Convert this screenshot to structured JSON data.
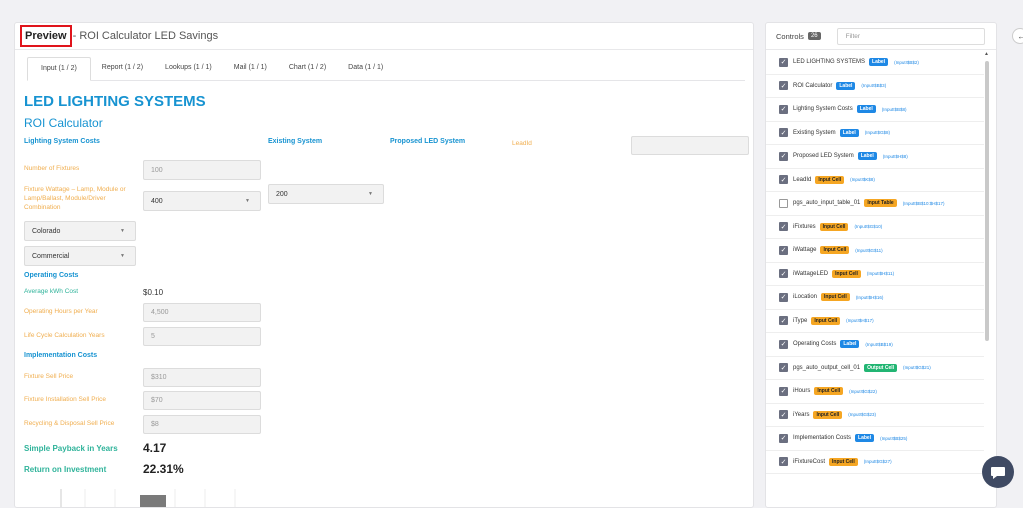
{
  "header": {
    "preview_label": "Preview",
    "title_rest": "- ROI Calculator LED Savings"
  },
  "tabs": [
    "Input (1 / 2)",
    "Report (1 / 2)",
    "Lookups (1 / 1)",
    "Mail (1 / 1)",
    "Chart (1 / 2)",
    "Data (1 / 1)"
  ],
  "sheet": {
    "title": "LED LIGHTING SYSTEMS",
    "subtitle": "ROI Calculator",
    "lighting_costs": "Lighting System Costs",
    "existing_system": "Existing System",
    "proposed_system": "Proposed LED System",
    "leadid_label": "LeadId",
    "leadid_value": "",
    "num_fixtures_label": "Number of Fixtures",
    "num_fixtures_value": "100",
    "wattage_label_1": "Fixture Wattage – Lamp, Module or",
    "wattage_label_2": "Lamp/Ballast, Module/Driver",
    "wattage_label_3": "Combination",
    "wattage_existing": "400",
    "wattage_led": "200",
    "location_value": "Colorado",
    "type_value": "Commercial",
    "operating_costs": "Operating Costs",
    "avg_kwh_label": "Average kWh Cost",
    "avg_kwh_value": "$0.10",
    "hours_label": "Operating Hours per Year",
    "hours_value": "4,500",
    "years_label": "Life Cycle Calculation Years",
    "years_value": "5",
    "implementation_costs": "Implementation Costs",
    "fixture_price_label": "Fixture Sell Price",
    "fixture_price_value": "$310",
    "install_price_label": "Fixture Installation Sell Price",
    "install_price_value": "$70",
    "recycle_label": "Recycling & Disposal Sell Price",
    "recycle_value": "$8",
    "payback_label": "Simple Payback in Years",
    "payback_value": "4.17",
    "roi_label": "Return on Investment",
    "roi_value": "22.31%"
  },
  "controls": {
    "title": "Controls",
    "count": "26",
    "filter_placeholder": "Filter",
    "items": [
      {
        "name": "LED LIGHTING SYSTEMS",
        "tag": "Label",
        "kind": "label",
        "ref": "(Input!$B$2)",
        "checked": true
      },
      {
        "name": "ROI Calculator",
        "tag": "Label",
        "kind": "label",
        "ref": "(Input!$B$3)",
        "checked": true
      },
      {
        "name": "Lighting System Costs",
        "tag": "Label",
        "kind": "label",
        "ref": "(Input!$B$8)",
        "checked": true
      },
      {
        "name": "Existing System",
        "tag": "Label",
        "kind": "label",
        "ref": "(Input!$G$8)",
        "checked": true
      },
      {
        "name": "Proposed LED System",
        "tag": "Label",
        "kind": "label",
        "ref": "(Input!$H$8)",
        "checked": true
      },
      {
        "name": "LeadId",
        "tag": "Input Cell",
        "kind": "input",
        "ref": "(Input!$K$8)",
        "checked": true
      },
      {
        "name": "pgs_auto_input_table_01",
        "tag": "Input Table",
        "kind": "input",
        "ref": "(Input!$B$10:$H$17)",
        "checked": false
      },
      {
        "name": "iFixtures",
        "tag": "Input Cell",
        "kind": "input",
        "ref": "(Input!$G$10)",
        "checked": true
      },
      {
        "name": "iWattage",
        "tag": "Input Cell",
        "kind": "input",
        "ref": "(Input!$G$11)",
        "checked": true
      },
      {
        "name": "iWattageLED",
        "tag": "Input Cell",
        "kind": "input",
        "ref": "(Input!$H$11)",
        "checked": true
      },
      {
        "name": "iLocation",
        "tag": "Input Cell",
        "kind": "input",
        "ref": "(Input!$H$16)",
        "checked": true
      },
      {
        "name": "iType",
        "tag": "Input Cell",
        "kind": "input",
        "ref": "(Input!$H$17)",
        "checked": true
      },
      {
        "name": "Operating Costs",
        "tag": "Label",
        "kind": "label",
        "ref": "(Input!$B$19)",
        "checked": true
      },
      {
        "name": "pgs_auto_output_cell_01",
        "tag": "Output Cell",
        "kind": "output",
        "ref": "(Input!$G$21)",
        "checked": true
      },
      {
        "name": "iHours",
        "tag": "Input Cell",
        "kind": "input",
        "ref": "(Input!$G$22)",
        "checked": true
      },
      {
        "name": "iYears",
        "tag": "Input Cell",
        "kind": "input",
        "ref": "(Input!$G$23)",
        "checked": true
      },
      {
        "name": "Implementation Costs",
        "tag": "Label",
        "kind": "label",
        "ref": "(Input!$B$25)",
        "checked": true
      },
      {
        "name": "iFixtureCost",
        "tag": "Input Cell",
        "kind": "input",
        "ref": "(Input!$G$27)",
        "checked": true
      }
    ]
  },
  "colors": {
    "accent_blue": "#1793d1",
    "label_orange": "#f0ae4f",
    "teal": "#2fb39a",
    "highlight_red": "#e0141b"
  }
}
